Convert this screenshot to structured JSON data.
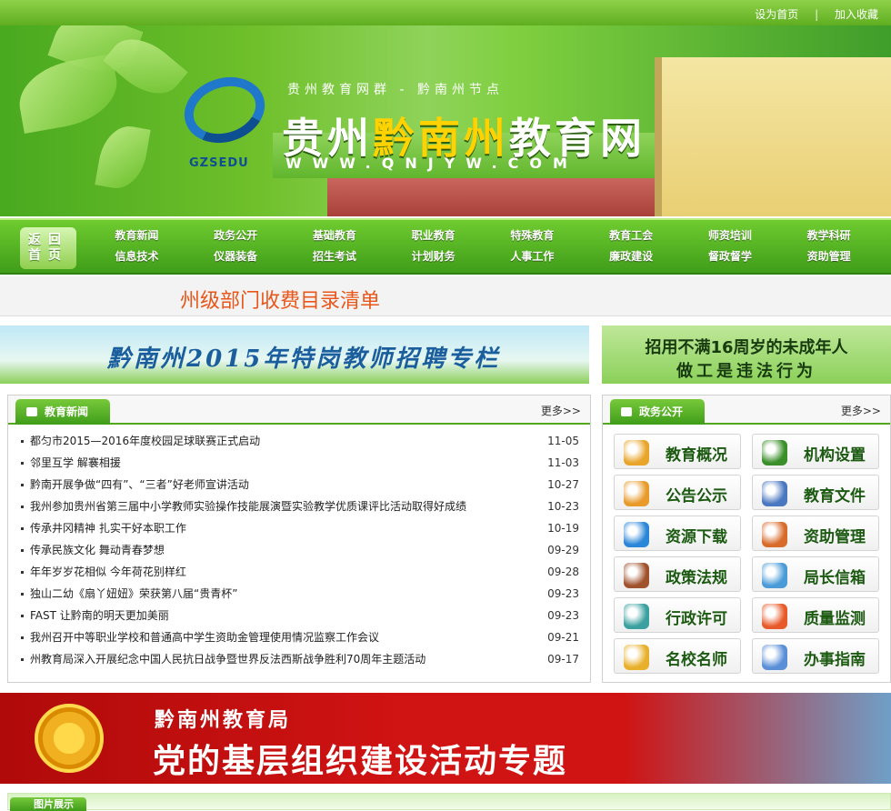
{
  "topbar": {
    "set_home": "设为首页",
    "separator": "|",
    "add_favorite": "加入收藏"
  },
  "banner": {
    "logo_text": "GZSEDU",
    "subtitle": "贵州教育网群 - 黔南州节点",
    "title_part1": "贵州",
    "title_highlight": "黔南州",
    "title_part2": "教育网",
    "url": "WWW.QNJYW.COM"
  },
  "nav": {
    "home_label": "返回 首页",
    "items": [
      "教育新闻",
      "政务公开",
      "基础教育",
      "职业教育",
      "特殊教育",
      "教育工会",
      "师资培训",
      "教学科研",
      "信息技术",
      "仪器装备",
      "招生考试",
      "计划财务",
      "人事工作",
      "廉政建设",
      "督政督学",
      "资助管理"
    ]
  },
  "notice": {
    "text": "州级部门收费目录清单"
  },
  "ads": {
    "left": "黔南州2015年特岗教师招聘专栏",
    "right_line1": "招用不满16周岁的未成年人",
    "right_line2": "做工是违法行为"
  },
  "news_panel": {
    "tab": "教育新闻",
    "more": "更多>>",
    "items": [
      {
        "title": "都匀市2015—2016年度校园足球联赛正式启动",
        "date": "11-05"
      },
      {
        "title": "邻里互学 解褰相援",
        "date": "11-03"
      },
      {
        "title": "黔南开展争做“四有”、“三者”好老师宣讲活动",
        "date": "10-27"
      },
      {
        "title": "我州参加贵州省第三届中小学教师实验操作技能展演暨实验教学优质课评比活动取得好成绩",
        "date": "10-23"
      },
      {
        "title": "传承井冈精神 扎实干好本职工作",
        "date": "10-19"
      },
      {
        "title": "传承民族文化 舞动青春梦想",
        "date": "09-29"
      },
      {
        "title": "年年岁岁花相似 今年荷花别样红",
        "date": "09-28"
      },
      {
        "title": "独山二幼《扇丫妞妞》荣获第八届“贵青杯”",
        "date": "09-23"
      },
      {
        "title": "FAST 让黔南的明天更加美丽",
        "date": "09-23"
      },
      {
        "title": "我州召开中等职业学校和普通高中学生资助金管理使用情况监察工作会议",
        "date": "09-21"
      },
      {
        "title": "州教育局深入开展纪念中国人民抗日战争暨世界反法西斯战争胜利70周年主题活动",
        "date": "09-17"
      }
    ]
  },
  "gov_panel": {
    "tab": "政务公开",
    "more": "更多>>",
    "buttons": [
      {
        "label": "教育概况",
        "icon": "pencil-cup-icon",
        "color": "#e8a52a"
      },
      {
        "label": "机构设置",
        "icon": "computer-icon",
        "color": "#3a8f2a"
      },
      {
        "label": "公告公示",
        "icon": "envelope-icon",
        "color": "#e89a2a"
      },
      {
        "label": "教育文件",
        "icon": "books-icon",
        "color": "#4a78c0"
      },
      {
        "label": "资源下载",
        "icon": "globe-download-icon",
        "color": "#2a86d8"
      },
      {
        "label": "资助管理",
        "icon": "house-icon",
        "color": "#d86a2a"
      },
      {
        "label": "政策法规",
        "icon": "law-books-icon",
        "color": "#a0522d"
      },
      {
        "label": "局长信箱",
        "icon": "butterfly-icon",
        "color": "#4a9bd8"
      },
      {
        "label": "行政许可",
        "icon": "magnifier-icon",
        "color": "#3aa0a0"
      },
      {
        "label": "质量监测",
        "icon": "pie-chart-icon",
        "color": "#e85a2a"
      },
      {
        "label": "名校名师",
        "icon": "people-icon",
        "color": "#e8b02a"
      },
      {
        "label": "办事指南",
        "icon": "person-pointer-icon",
        "color": "#5a8fd8"
      }
    ]
  },
  "party_banner": {
    "line1": "黔南州教育局",
    "line2": "党的基层组织建设活动专题"
  },
  "photo_panel": {
    "tab": "图片展示"
  }
}
